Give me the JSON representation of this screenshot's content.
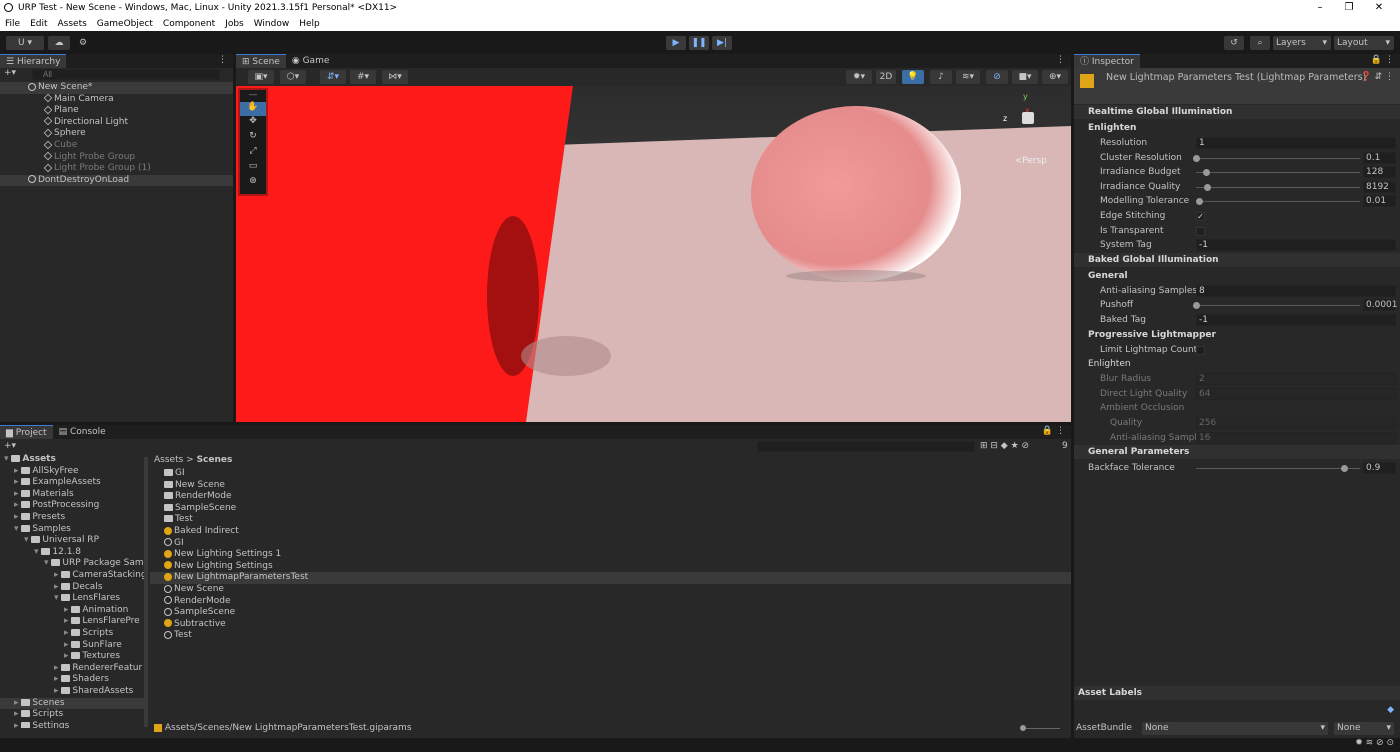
{
  "window": {
    "title": "URP Test - New Scene - Windows, Mac, Linux - Unity 2021.3.15f1 Personal* <DX11>",
    "minimize": "–",
    "maximize": "❐",
    "close": "✕"
  },
  "menu": [
    "File",
    "Edit",
    "Assets",
    "GameObject",
    "Component",
    "Jobs",
    "Window",
    "Help"
  ],
  "toolbar": {
    "account": "U",
    "layers": "Layers",
    "layout": "Layout"
  },
  "hierarchy": {
    "tab": "Hierarchy",
    "search_placeholder": "All",
    "items": [
      {
        "label": "New Scene*",
        "kind": "unity",
        "indent": 0,
        "dim": false,
        "sel": true
      },
      {
        "label": "Main Camera",
        "kind": "gobj",
        "indent": 1,
        "dim": false
      },
      {
        "label": "Plane",
        "kind": "gobj",
        "indent": 1,
        "dim": false,
        "arrow": true
      },
      {
        "label": "Directional Light",
        "kind": "gobj",
        "indent": 1,
        "dim": false
      },
      {
        "label": "Sphere",
        "kind": "gobj",
        "indent": 1,
        "dim": false
      },
      {
        "label": "Cube",
        "kind": "gobj",
        "indent": 1,
        "dim": true
      },
      {
        "label": "Light Probe Group",
        "kind": "gobj",
        "indent": 1,
        "dim": true
      },
      {
        "label": "Light Probe Group (1)",
        "kind": "gobj",
        "indent": 1,
        "dim": true
      },
      {
        "label": "DontDestroyOnLoad",
        "kind": "unity",
        "indent": 0,
        "dim": false,
        "sel": true
      }
    ]
  },
  "scene": {
    "tabs": [
      "Scene",
      "Game"
    ],
    "mode_2d": "2D",
    "persp": "<Persp",
    "gizmo_x": "x",
    "gizmo_y": "y",
    "gizmo_z": "z"
  },
  "project": {
    "tabs": [
      "Project",
      "Console"
    ],
    "breadcrumb": [
      "Assets",
      "Scenes"
    ],
    "count": "9",
    "search_placeholder": "",
    "tree": [
      {
        "label": "Assets",
        "indent": 0,
        "bold": true,
        "open": true
      },
      {
        "label": "AllSkyFree",
        "indent": 1
      },
      {
        "label": "ExampleAssets",
        "indent": 1
      },
      {
        "label": "Materials",
        "indent": 1
      },
      {
        "label": "PostProcessing",
        "indent": 1
      },
      {
        "label": "Presets",
        "indent": 1
      },
      {
        "label": "Samples",
        "indent": 1,
        "open": true
      },
      {
        "label": "Universal RP",
        "indent": 2,
        "open": true
      },
      {
        "label": "12.1.8",
        "indent": 3,
        "open": true
      },
      {
        "label": "URP Package Sam",
        "indent": 4,
        "open": true
      },
      {
        "label": "CameraStacking",
        "indent": 5
      },
      {
        "label": "Decals",
        "indent": 5
      },
      {
        "label": "LensFlares",
        "indent": 5,
        "open": true
      },
      {
        "label": "Animation",
        "indent": 6
      },
      {
        "label": "LensFlarePre",
        "indent": 6
      },
      {
        "label": "Scripts",
        "indent": 6
      },
      {
        "label": "SunFlare",
        "indent": 6
      },
      {
        "label": "Textures",
        "indent": 6
      },
      {
        "label": "RendererFeatur",
        "indent": 5
      },
      {
        "label": "Shaders",
        "indent": 5
      },
      {
        "label": "SharedAssets",
        "indent": 5
      },
      {
        "label": "Scenes",
        "indent": 1,
        "sel": true
      },
      {
        "label": "Scripts",
        "indent": 1
      },
      {
        "label": "Settings",
        "indent": 1
      }
    ],
    "files": [
      {
        "label": "GI",
        "kind": "folder"
      },
      {
        "label": "New Scene",
        "kind": "folder"
      },
      {
        "label": "RenderMode",
        "kind": "folder"
      },
      {
        "label": "SampleScene",
        "kind": "folder"
      },
      {
        "label": "Test",
        "kind": "folder"
      },
      {
        "label": "Baked Indirect",
        "kind": "yellow"
      },
      {
        "label": "GI",
        "kind": "unity"
      },
      {
        "label": "New Lighting Settings 1",
        "kind": "yellow"
      },
      {
        "label": "New Lighting Settings",
        "kind": "yellow"
      },
      {
        "label": "New LightmapParametersTest",
        "kind": "yellow",
        "sel": true
      },
      {
        "label": "New Scene",
        "kind": "unity"
      },
      {
        "label": "RenderMode",
        "kind": "unity"
      },
      {
        "label": "SampleScene",
        "kind": "unity"
      },
      {
        "label": "Subtractive",
        "kind": "yellow"
      },
      {
        "label": "Test",
        "kind": "unity"
      }
    ],
    "path": "Assets/Scenes/New LightmapParametersTest.giparams"
  },
  "inspector": {
    "tab": "Inspector",
    "title": "New Lightmap Parameters Test (Lightmap Parameters)",
    "sections": [
      {
        "type": "hdr",
        "label": "Realtime Global Illumination"
      },
      {
        "type": "sub",
        "label": "Enlighten"
      },
      {
        "type": "field",
        "label": "Resolution",
        "value": "1"
      },
      {
        "type": "slider",
        "label": "Cluster Resolution",
        "value": "0.1",
        "frac": 0.0
      },
      {
        "type": "slider",
        "label": "Irradiance Budget",
        "value": "128",
        "frac": 0.06
      },
      {
        "type": "slider",
        "label": "Irradiance Quality",
        "value": "8192",
        "frac": 0.07
      },
      {
        "type": "slider",
        "label": "Modelling Tolerance",
        "value": "0.01",
        "frac": 0.02
      },
      {
        "type": "check",
        "label": "Edge Stitching",
        "checked": true
      },
      {
        "type": "check",
        "label": "Is Transparent",
        "checked": false
      },
      {
        "type": "field",
        "label": "System Tag",
        "value": "-1"
      },
      {
        "type": "hdr",
        "label": "Baked Global Illumination"
      },
      {
        "type": "sub",
        "label": "General"
      },
      {
        "type": "field",
        "label": "Anti-aliasing Samples",
        "value": "8"
      },
      {
        "type": "slider",
        "label": "Pushoff",
        "value": "0.0001",
        "frac": 0.0
      },
      {
        "type": "field",
        "label": "Baked Tag",
        "value": "-1"
      },
      {
        "type": "sub",
        "label": "Progressive Lightmapper"
      },
      {
        "type": "check",
        "label": "Limit Lightmap Count",
        "checked": false
      },
      {
        "type": "subdim",
        "label": "Enlighten"
      },
      {
        "type": "fielddim",
        "label": "Blur Radius",
        "value": "2"
      },
      {
        "type": "fielddim",
        "label": "Direct Light Quality",
        "value": "64"
      },
      {
        "type": "labeldim",
        "label": "Ambient Occlusion"
      },
      {
        "type": "fielddim2",
        "label": "Quality",
        "value": "256"
      },
      {
        "type": "fielddim2",
        "label": "Anti-aliasing Sample",
        "value": "16"
      },
      {
        "type": "hdr",
        "label": "General Parameters"
      },
      {
        "type": "slider2",
        "label": "Backface Tolerance",
        "value": "0.9",
        "frac": 0.9
      }
    ],
    "asset_labels": "Asset Labels",
    "asset_bundle": "AssetBundle",
    "bundle_value": "None",
    "variant_value": "None"
  }
}
